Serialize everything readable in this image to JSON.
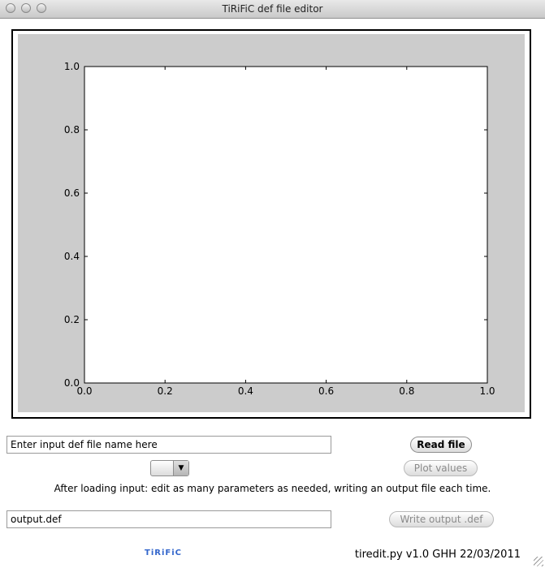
{
  "window": {
    "title": "TiRiFiC def file editor"
  },
  "chart_data": {
    "type": "line",
    "title": "",
    "xlabel": "",
    "ylabel": "",
    "xlim": [
      0.0,
      1.0
    ],
    "ylim": [
      0.0,
      1.0
    ],
    "xticks": [
      "0.0",
      "0.2",
      "0.4",
      "0.6",
      "0.8",
      "1.0"
    ],
    "yticks": [
      "0.0",
      "0.2",
      "0.4",
      "0.6",
      "0.8",
      "1.0"
    ],
    "series": [],
    "grid": false
  },
  "controls": {
    "input_field": {
      "value": "Enter input def file name here"
    },
    "read_button": {
      "label": "Read file"
    },
    "dropdown": {
      "selected": ""
    },
    "plot_button": {
      "label": "Plot values"
    },
    "instructions": "After loading input: edit as many parameters as needed, writing an output file each time.",
    "output_field": {
      "value": "output.def"
    },
    "write_button": {
      "label": "Write output .def"
    }
  },
  "footer": {
    "logo": "TiRiFiC",
    "version": "tiredit.py v1.0 GHH 22/03/2011"
  },
  "colors": {
    "figure_background": "#cccccc",
    "axes_background": "#ffffff",
    "logo": "#3366cc"
  },
  "icons": [
    "dropdown-arrow-icon",
    "window-close-icon",
    "window-minimize-icon",
    "window-zoom-icon",
    "resize-grip-icon"
  ]
}
